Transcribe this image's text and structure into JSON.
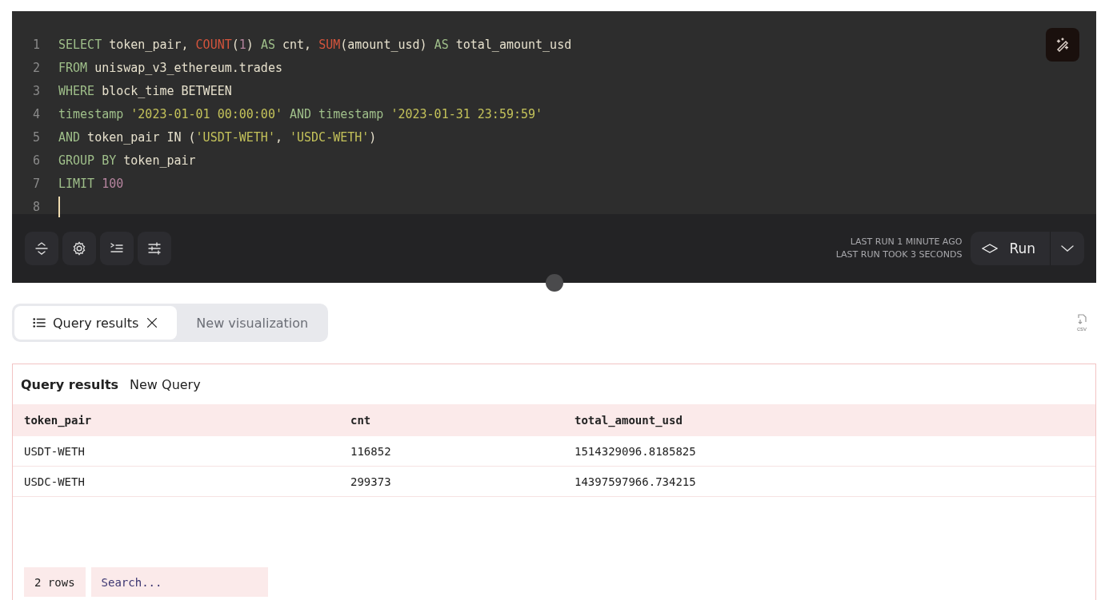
{
  "editor": {
    "lines": [
      {
        "number": "1",
        "tokens": [
          {
            "text": "SELECT",
            "kind": "keyword"
          },
          {
            "text": " token_pair, ",
            "kind": "ident"
          },
          {
            "text": "COUNT",
            "kind": "function"
          },
          {
            "text": "(",
            "kind": "ident"
          },
          {
            "text": "1",
            "kind": "number"
          },
          {
            "text": ") ",
            "kind": "ident"
          },
          {
            "text": "AS",
            "kind": "keyword"
          },
          {
            "text": " cnt, ",
            "kind": "ident"
          },
          {
            "text": "SUM",
            "kind": "function"
          },
          {
            "text": "(amount_usd) ",
            "kind": "ident"
          },
          {
            "text": "AS",
            "kind": "keyword"
          },
          {
            "text": " total_amount_usd",
            "kind": "ident"
          }
        ]
      },
      {
        "number": "2",
        "tokens": [
          {
            "text": "FROM",
            "kind": "keyword"
          },
          {
            "text": " uniswap_v3_ethereum.trades",
            "kind": "ident"
          }
        ]
      },
      {
        "number": "3",
        "tokens": [
          {
            "text": "WHERE",
            "kind": "keyword"
          },
          {
            "text": " block_time BETWEEN",
            "kind": "ident"
          }
        ]
      },
      {
        "number": "4",
        "tokens": [
          {
            "text": "timestamp",
            "kind": "keyword"
          },
          {
            "text": " '2023-01-01 00:00:00' ",
            "kind": "string"
          },
          {
            "text": "AND timestamp",
            "kind": "keyword"
          },
          {
            "text": " '2023-01-31 23:59:59'",
            "kind": "string"
          }
        ]
      },
      {
        "number": "5",
        "tokens": [
          {
            "text": "AND",
            "kind": "keyword"
          },
          {
            "text": " token_pair IN (",
            "kind": "ident"
          },
          {
            "text": "'USDT-WETH'",
            "kind": "string"
          },
          {
            "text": ", ",
            "kind": "ident"
          },
          {
            "text": "'USDC-WETH'",
            "kind": "string"
          },
          {
            "text": ")",
            "kind": "ident"
          }
        ]
      },
      {
        "number": "6",
        "tokens": [
          {
            "text": "GROUP BY",
            "kind": "keyword"
          },
          {
            "text": " token_pair",
            "kind": "ident"
          }
        ]
      },
      {
        "number": "7",
        "tokens": [
          {
            "text": "LIMIT",
            "kind": "keyword"
          },
          {
            "text": " 100",
            "kind": "number"
          }
        ]
      },
      {
        "number": "8",
        "cursor": true
      }
    ]
  },
  "toolbar": {
    "last_run": "LAST RUN 1 MINUTE AGO",
    "last_duration": "LAST RUN TOOK 3 SECONDS",
    "run_button": "Run"
  },
  "tabs": [
    {
      "label": "Query results",
      "selected": true
    },
    {
      "label": "New visualization",
      "selected": false
    }
  ],
  "csv_icon_label": "csv",
  "results": {
    "title": "Query results",
    "subtitle": "New Query",
    "columns": [
      "token_pair",
      "cnt",
      "total_amount_usd"
    ],
    "rows": [
      [
        "USDT-WETH",
        "116852",
        "1514329096.8185825"
      ],
      [
        "USDC-WETH",
        "299373",
        "14397597966.734215"
      ]
    ],
    "row_count": "2 rows",
    "search": {
      "placeholder": "Search..."
    }
  }
}
